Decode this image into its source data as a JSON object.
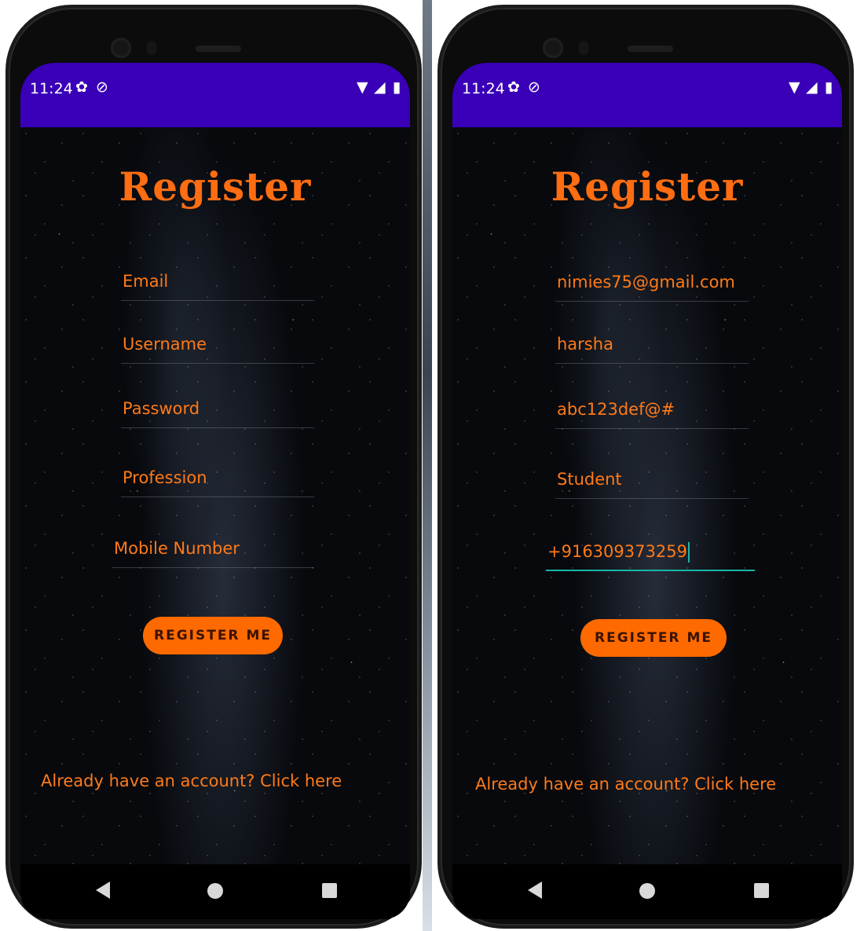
{
  "phones": [
    {
      "status": {
        "time": "11:24"
      },
      "screen": {
        "title": "Register",
        "fields": {
          "email": "Email",
          "username": "Username",
          "password": "Password",
          "profession": "Profession",
          "mobile": "Mobile Number"
        },
        "register_button": "REGISTER ME",
        "login_link": "Already have an account? Click here"
      }
    },
    {
      "status": {
        "time": "11:24"
      },
      "screen": {
        "title": "Register",
        "fields": {
          "email": "nimies75@gmail.com",
          "username": "harsha",
          "password": "abc123def@#",
          "profession": "Student",
          "mobile": "+916309373259"
        },
        "register_button": "REGISTER ME",
        "login_link": "Already have an account? Click here"
      }
    }
  ],
  "colors": {
    "status_bar": "#3a00b8",
    "accent_text": "#ff6d12",
    "button": "#ff6a00",
    "focus_underline": "#1ab6a6"
  },
  "icons": [
    "settings-icon",
    "sync-icon",
    "wifi-icon",
    "signal-icon",
    "battery-icon",
    "nav-back-icon",
    "nav-home-icon",
    "nav-recent-icon"
  ]
}
